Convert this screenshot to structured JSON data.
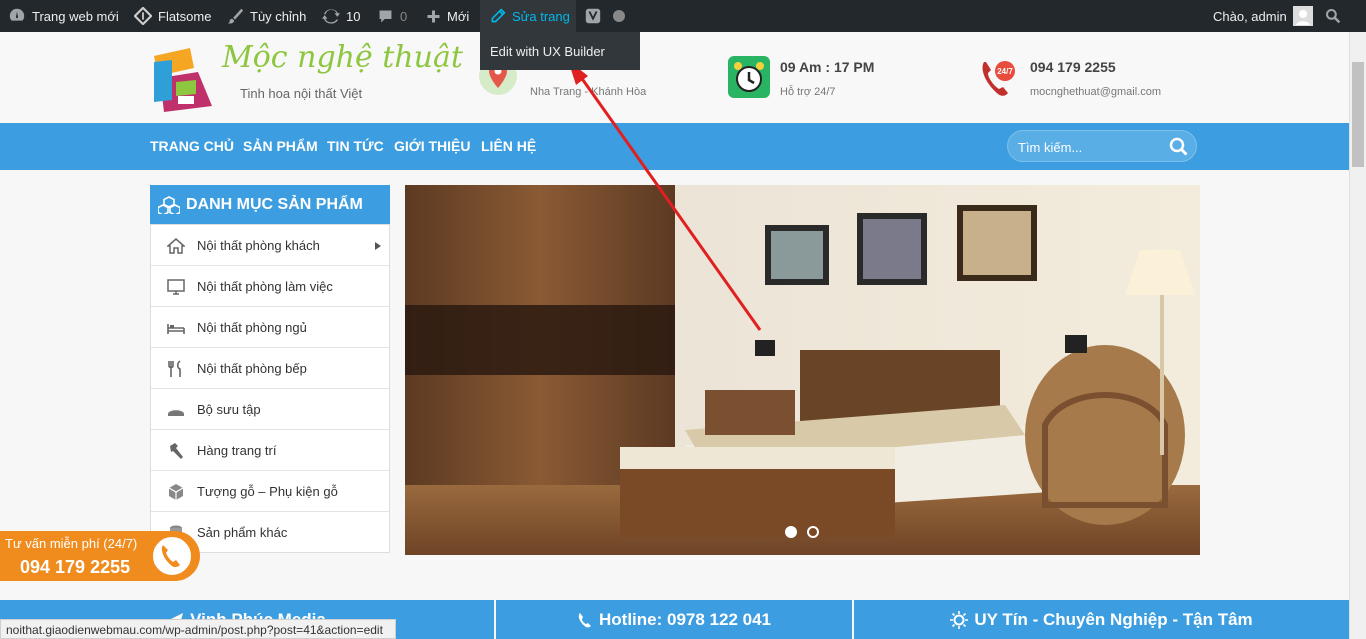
{
  "admin_bar": {
    "site_name": "Trang web mới",
    "theme": "Flatsome",
    "customize": "Tùy chỉnh",
    "updates_count": "10",
    "comments_count": "0",
    "new_label": "Mới",
    "edit_page": "Sửa trang",
    "greeting": "Chào, admin",
    "dropdown_item": "Edit with UX Builder"
  },
  "header": {
    "logo_title": "Mộc nghệ thuật",
    "logo_tagline": "Tinh hoa nội thất Việt",
    "address_sub": "Nha Trang - Khánh Hòa",
    "hours_title": "09 Am : 17 PM",
    "hours_sub": "Hỗ trợ 24/7",
    "phone_title": "094 179 2255",
    "phone_sub": "mocnghethuat@gmail.com",
    "phone_badge": "24/7"
  },
  "nav": {
    "items": [
      "TRANG CHỦ",
      "SẢN PHẨM",
      "TIN TỨC",
      "GIỚI THIỆU",
      "LIÊN HỆ"
    ],
    "search_placeholder": "Tìm kiếm..."
  },
  "categories": {
    "title": "DANH MỤC SẢN PHẨM",
    "items": [
      {
        "label": "Nội thất phòng khách",
        "icon": "home-icon"
      },
      {
        "label": "Nội thất phòng làm việc",
        "icon": "monitor-icon"
      },
      {
        "label": "Nội thất phòng ngủ",
        "icon": "bed-icon"
      },
      {
        "label": "Nội thất phòng bếp",
        "icon": "cutlery-icon"
      },
      {
        "label": "Bộ sưu tập",
        "icon": "collection-icon"
      },
      {
        "label": "Hàng trang trí",
        "icon": "hammer-icon"
      },
      {
        "label": "Tượng gỗ – Phụ kiện gỗ",
        "icon": "cube-icon"
      },
      {
        "label": "Sản phẩm khác",
        "icon": "database-icon"
      }
    ]
  },
  "consult": {
    "label": "Tư vấn miễn phí (24/7)",
    "phone": "094 179 2255"
  },
  "footer_bar": {
    "left": "Vinh Phúc Media",
    "middle": "Hotline: 0978 122 041",
    "right": "UY Tín - Chuyên Nghiệp - Tận Tâm"
  },
  "status_url": "noithat.giaodienwebmau.com/wp-admin/post.php?post=41&action=edit",
  "colors": {
    "admin_bar": "#23282d",
    "brand_blue": "#3c9de0",
    "accent_orange": "#f08c1e",
    "logo_green": "#8dc63f",
    "annotation_red": "#e02020"
  }
}
